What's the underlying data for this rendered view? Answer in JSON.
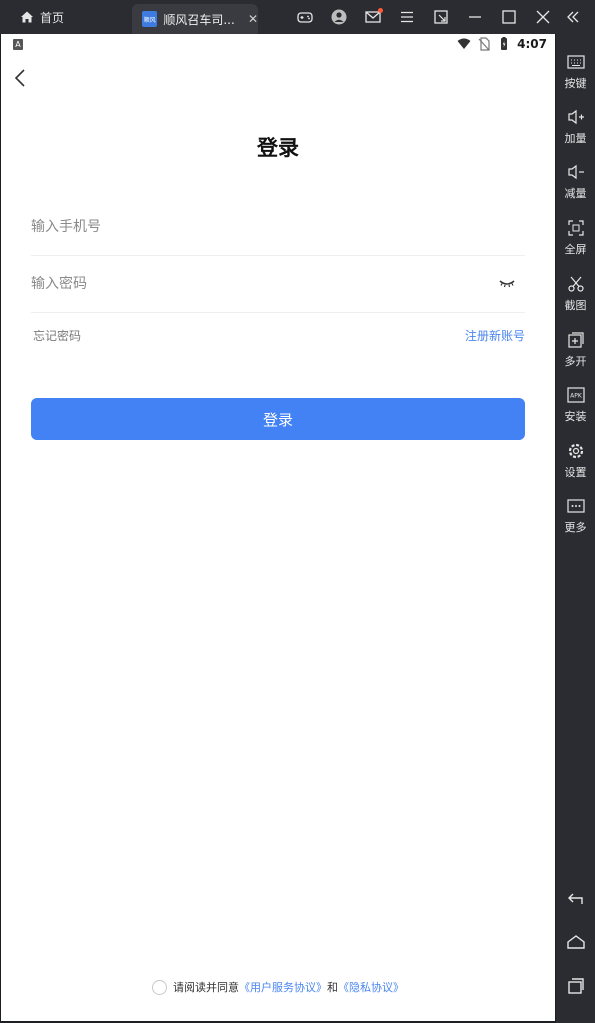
{
  "emulator": {
    "home_tab_label": "首页",
    "app_tab_title": "顺风召车司...",
    "app_tab_icon_text": "顺风",
    "tab_close_glyph": "✕",
    "toolbar_icons": [
      "gamepad-icon",
      "user-icon",
      "mail-icon",
      "menu-icon",
      "restore-icon",
      "minimize-icon",
      "maximize-icon",
      "close-icon"
    ],
    "sidebar": [
      {
        "label": "按键",
        "icon": "keyboard-icon"
      },
      {
        "label": "加量",
        "icon": "volume-up-icon"
      },
      {
        "label": "减量",
        "icon": "volume-down-icon"
      },
      {
        "label": "全屏",
        "icon": "fullscreen-icon"
      },
      {
        "label": "截图",
        "icon": "scissors-icon"
      },
      {
        "label": "多开",
        "icon": "multi-instance-icon"
      },
      {
        "label": "安装",
        "icon": "apk-install-icon"
      },
      {
        "label": "设置",
        "icon": "settings-icon"
      },
      {
        "label": "更多",
        "icon": "more-icon"
      }
    ],
    "apk_text": "APK"
  },
  "status_bar": {
    "time": "4:07",
    "notification_letter": "A"
  },
  "login": {
    "title": "登录",
    "phone_placeholder": "输入手机号",
    "password_placeholder": "输入密码",
    "forgot_password": "忘记密码",
    "register": "注册新账号",
    "submit": "登录"
  },
  "agreement": {
    "prefix": "请阅读并同意",
    "user_agreement": "《用户服务协议》",
    "and": "和",
    "privacy_policy": "《隐私协议》"
  }
}
